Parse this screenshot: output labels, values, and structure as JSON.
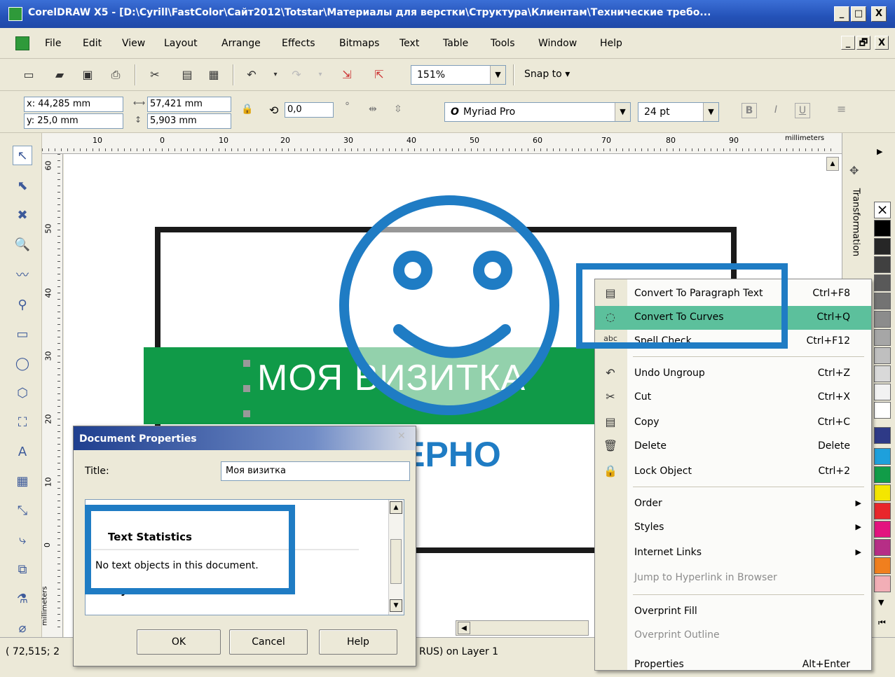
{
  "window": {
    "title": "CorelDRAW X5 - [D:\\Cyrill\\FastColor\\Сайт2012\\Totstar\\Материалы для верстки\\Структура\\Клиентам\\Технические требо...",
    "min": "_",
    "max": "□",
    "close": "X",
    "doc_min": "_",
    "doc_restore": "🗗",
    "doc_close": "X"
  },
  "menu": [
    "File",
    "Edit",
    "View",
    "Layout",
    "Arrange",
    "Effects",
    "Bitmaps",
    "Text",
    "Table",
    "Tools",
    "Window",
    "Help"
  ],
  "toolbar": {
    "zoom": "151%",
    "snap": "Snap to"
  },
  "propbar": {
    "x": "x: 44,285 mm",
    "y": "y: 25,0 mm",
    "w": "57,421 mm",
    "h": "5,903 mm",
    "angle": "0,0",
    "degree": "°",
    "font": "Myriad Pro",
    "size": "24 pt",
    "bold": "B",
    "italic": "I",
    "underline": "U"
  },
  "ruler": {
    "units": "millimeters",
    "top_ticks": [
      "10",
      "0",
      "10",
      "20",
      "30",
      "40",
      "50",
      "60",
      "70",
      "80",
      "90"
    ],
    "left_ticks": [
      "60",
      "50",
      "40",
      "30",
      "20",
      "10",
      "0"
    ],
    "left_units": "millimeters"
  },
  "canvas": {
    "card_text": "МОЯ ВИЗИТКА",
    "verdict": "ВЕРНО"
  },
  "docker": {
    "label": "Transformation"
  },
  "context_menu": {
    "items": [
      {
        "label": "Convert To Paragraph Text",
        "shortcut": "Ctrl+F8"
      },
      {
        "label": "Convert To Curves",
        "shortcut": "Ctrl+Q"
      },
      {
        "label": "Spell Check...",
        "shortcut": "Ctrl+F12"
      },
      {
        "label": "Undo Ungroup",
        "shortcut": "Ctrl+Z"
      },
      {
        "label": "Cut",
        "shortcut": "Ctrl+X"
      },
      {
        "label": "Copy",
        "shortcut": "Ctrl+C"
      },
      {
        "label": "Delete",
        "shortcut": "Delete"
      },
      {
        "label": "Lock Object",
        "shortcut": "Ctrl+2"
      },
      {
        "label": "Order",
        "shortcut": ""
      },
      {
        "label": "Styles",
        "shortcut": ""
      },
      {
        "label": "Internet Links",
        "shortcut": ""
      },
      {
        "label": "Jump to Hyperlink in Browser",
        "shortcut": ""
      },
      {
        "label": "Overprint Fill",
        "shortcut": ""
      },
      {
        "label": "Overprint Outline",
        "shortcut": ""
      },
      {
        "label": "Properties",
        "shortcut": "Alt+Enter"
      }
    ]
  },
  "dialog": {
    "title": "Document Properties",
    "title_label": "Title:",
    "title_value": "Моя визитка",
    "section": "Text Statistics",
    "message": "No text objects in this document.",
    "next_section": "Styles",
    "ok": "OK",
    "cancel": "Cancel",
    "help": "Help"
  },
  "status": {
    "coords": "( 72,515; 2",
    "layer": "RUS) on Layer 1"
  },
  "colors": {
    "highlight": "#5cc09c",
    "annotation_blue": "#1f7cc4",
    "card_green": "#109a48",
    "palette": [
      "#000000",
      "#262626",
      "#404040",
      "#595959",
      "#737373",
      "#8c8c8c",
      "#a6a6a6",
      "#bfbfbf",
      "#d9d9d9",
      "#f2f2f2",
      "#ffffff",
      "#2e3a87",
      "#1ea0dc",
      "#119c48",
      "#f4e600",
      "#e8262b",
      "#e3137f",
      "#b62e86",
      "#f07f1e",
      "#f2aeb6"
    ]
  }
}
